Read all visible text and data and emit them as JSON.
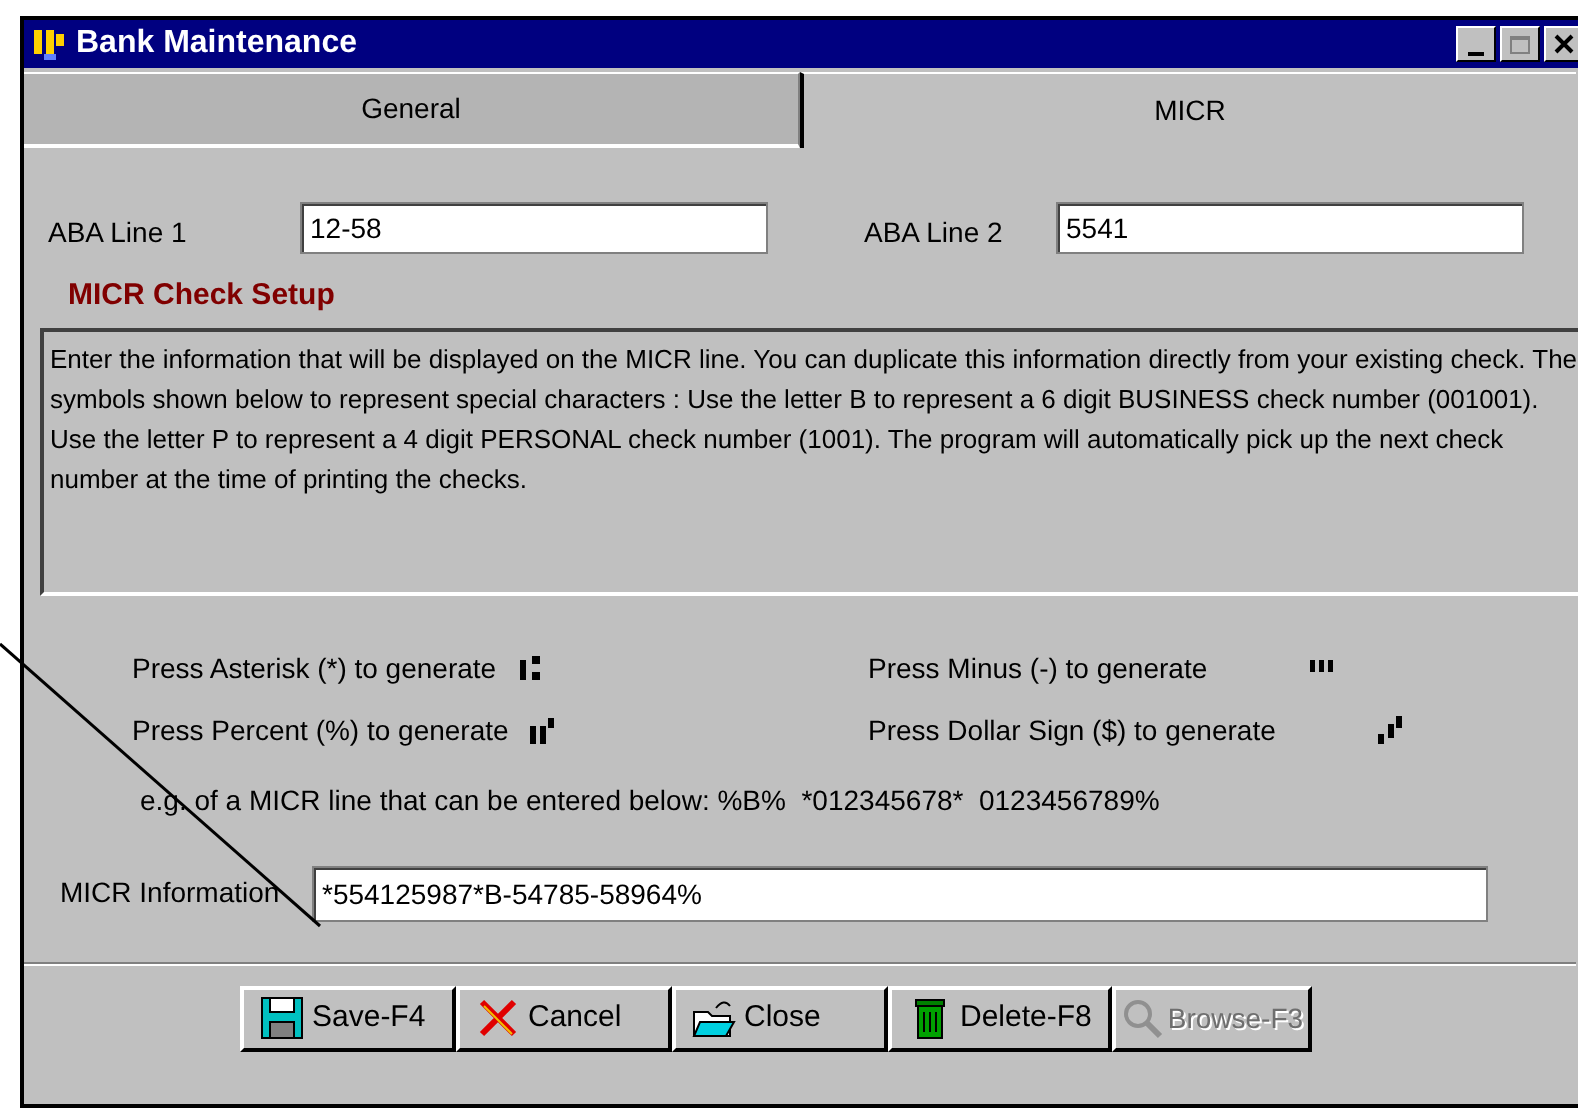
{
  "window": {
    "title": "Bank Maintenance"
  },
  "tabs": [
    {
      "label": "General",
      "selected": false
    },
    {
      "label": "MICR",
      "selected": true
    }
  ],
  "fields": [
    {
      "label": "ABA Line 1",
      "value": "12-58"
    },
    {
      "label": "ABA Line 2",
      "value": "5541"
    }
  ],
  "section_title": "MICR Check Setup",
  "description": "Enter the information that will be displayed on the MICR line.  You can duplicate this information directly from your existing check.  The symbols shown below to represent special characters : Use the letter B to represent a 6 digit BUSINESS check number (001001). Use the letter P to represent a 4 digit PERSONAL check number (1001). The program will automatically pick up the next check number at the time of printing the checks.",
  "symbols": [
    {
      "text": "Press Asterisk (*) to generate",
      "kind": "transit"
    },
    {
      "text": "Press Minus (-) to generate",
      "kind": "dash"
    },
    {
      "text": "Press Percent (%) to generate",
      "kind": "onus"
    },
    {
      "text": "Press Dollar Sign ($) to generate",
      "kind": "amount"
    }
  ],
  "example": "e.g. of a MICR line that can be entered below: %B%  *012345678*  0123456789%",
  "micr_field": {
    "label": "MICR Information",
    "value": "*554125987*B-54785-58964%"
  },
  "buttons": [
    {
      "label": "Save-F4",
      "kind": "save",
      "disabled": false
    },
    {
      "label": "Cancel",
      "kind": "cancel",
      "disabled": false
    },
    {
      "label": "Close",
      "kind": "close",
      "disabled": false
    },
    {
      "label": "Delete-F8",
      "kind": "delete",
      "disabled": false
    },
    {
      "label": "Browse-F3",
      "kind": "browse",
      "disabled": true
    }
  ]
}
